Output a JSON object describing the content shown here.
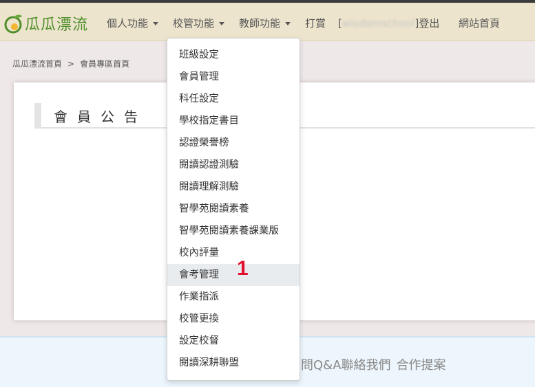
{
  "brand": {
    "name": "瓜瓜漂流",
    "logo_icon": "melon-leaf-logo",
    "accent": "#4f8f2a"
  },
  "nav": {
    "items": [
      {
        "label": "個人功能",
        "has_caret": true
      },
      {
        "label": "校管功能",
        "has_caret": true
      },
      {
        "label": "教師功能",
        "has_caret": true
      },
      {
        "label": "打賞",
        "has_caret": false
      }
    ],
    "user_open": "[",
    "user_name": "wisdomschool",
    "user_close": "]",
    "logout": "登出",
    "home": "網站首頁"
  },
  "breadcrumb": {
    "items": [
      "瓜瓜漂流首頁",
      "會員專區首頁"
    ],
    "separator": ">"
  },
  "announcement": {
    "title": "會員公告"
  },
  "dropdown": {
    "items": [
      "班級設定",
      "會員管理",
      "科任設定",
      "學校指定書目",
      "認證榮譽榜",
      "閱讀認證測驗",
      "閱讀理解測驗",
      "智學苑閱讀素養",
      "智學苑閱讀素養課業版",
      "校內評量",
      "會考管理",
      "作業指派",
      "校管更換",
      "設定校督",
      "閱讀深耕聯盟"
    ],
    "active_index": 10
  },
  "footer": {
    "links": [
      "問Q&A聯絡我們",
      "合作提案"
    ]
  },
  "annotation": {
    "marker": "1",
    "color": "#e3102d"
  }
}
